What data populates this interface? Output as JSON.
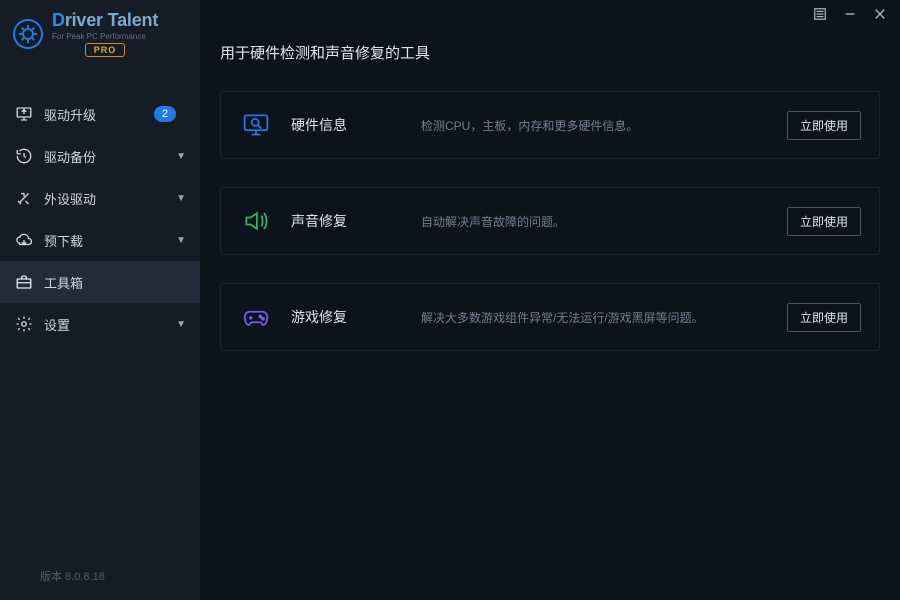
{
  "brand": {
    "name_first": "D",
    "name_rest": "river Talent",
    "tagline": "For Peak PC Performance",
    "pro": "PRO"
  },
  "sidebar": {
    "items": [
      {
        "label": "驱动升级",
        "badge": "2"
      },
      {
        "label": "驱动备份"
      },
      {
        "label": "外设驱动"
      },
      {
        "label": "预下载"
      },
      {
        "label": "工具箱"
      },
      {
        "label": "设置"
      }
    ]
  },
  "version": "版本 8.0.8.18",
  "page": {
    "title": "用于硬件检测和声音修复的工具"
  },
  "tools": [
    {
      "name": "硬件信息",
      "desc": "检测CPU，主板，内存和更多硬件信息。",
      "cta": "立即使用"
    },
    {
      "name": "声音修复",
      "desc": "自动解决声音故障的问题。",
      "cta": "立即使用"
    },
    {
      "name": "游戏修复",
      "desc": "解决大多数游戏组件异常/无法运行/游戏黑屏等问题。",
      "cta": "立即使用"
    }
  ]
}
